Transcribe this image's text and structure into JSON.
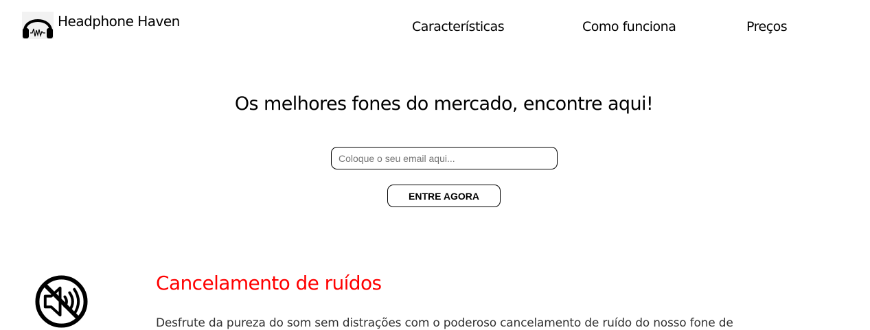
{
  "header": {
    "logo_icon": "headphones-icon",
    "brand": "Headphone Haven",
    "nav": [
      {
        "label": "Características"
      },
      {
        "label": "Como funciona"
      },
      {
        "label": "Preços"
      }
    ]
  },
  "hero": {
    "title": "Os melhores fones do mercado, encontre aqui!",
    "email_placeholder": "Coloque o seu email aqui...",
    "email_value": "",
    "cta_label": "ENTRE AGORA"
  },
  "feature": {
    "icon": "mute-icon",
    "title": "Cancelamento de ruídos",
    "title_color": "#ff0000",
    "text": "Desfrute da pureza do som sem distrações com o poderoso cancelamento de ruído do nosso fone de"
  }
}
